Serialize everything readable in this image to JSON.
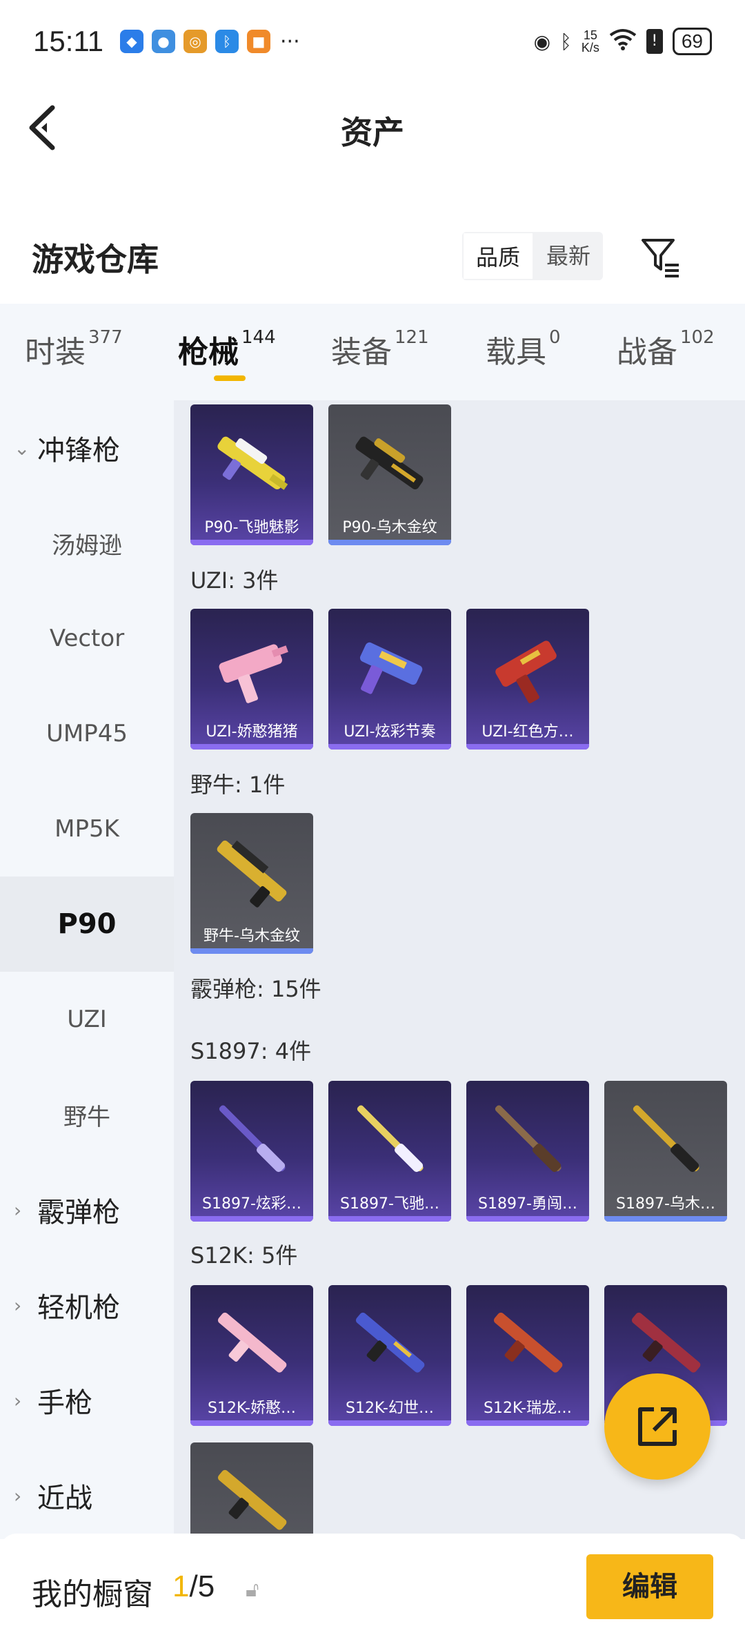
{
  "status_bar": {
    "time": "15:11",
    "speed_top": "15",
    "speed_bottom": "K/s",
    "battery": "69",
    "more": "···"
  },
  "nav": {
    "title": "资产"
  },
  "section": {
    "title": "游戏仓库",
    "sort_options": [
      "品质",
      "最新"
    ]
  },
  "tabs": [
    {
      "label": "时装",
      "count": "377"
    },
    {
      "label": "枪械",
      "count": "144"
    },
    {
      "label": "装备",
      "count": "121"
    },
    {
      "label": "载具",
      "count": "0"
    },
    {
      "label": "战备",
      "count": "102"
    }
  ],
  "sidebar": {
    "group_smg": "冲锋枪",
    "smg_items": [
      "汤姆逊",
      "Vector",
      "UMP45",
      "MP5K",
      "P90",
      "UZI",
      "野牛"
    ],
    "groups_bottom": [
      "霰弹枪",
      "轻机枪",
      "手枪",
      "近战"
    ]
  },
  "content": {
    "p90_cards": [
      "P90-飞驰魅影",
      "P90-乌木金纹"
    ],
    "uzi_header": "UZI: 3件",
    "uzi_cards": [
      "UZI-娇憨猪猪",
      "UZI-炫彩节奏",
      "UZI-红色方…"
    ],
    "bison_header": "野牛: 1件",
    "bison_cards": [
      "野牛-乌木金纹"
    ],
    "shotgun_header": "霰弹枪: 15件",
    "s1897_header": "S1897: 4件",
    "s1897_cards": [
      "S1897-炫彩…",
      "S1897-飞驰…",
      "S1897-勇闯…",
      "S1897-乌木…"
    ],
    "s12k_header": "S12K: 5件",
    "s12k_cards": [
      "S12K-娇憨…",
      "S12K-幻世…",
      "S12K-瑞龙…"
    ]
  },
  "bottom": {
    "title": "我的橱窗",
    "current": "1",
    "total": "/5",
    "edit": "编辑"
  },
  "colors": {
    "accent": "#f7b718",
    "card_purple": "#3b2f77",
    "card_gray": "#55565c"
  }
}
